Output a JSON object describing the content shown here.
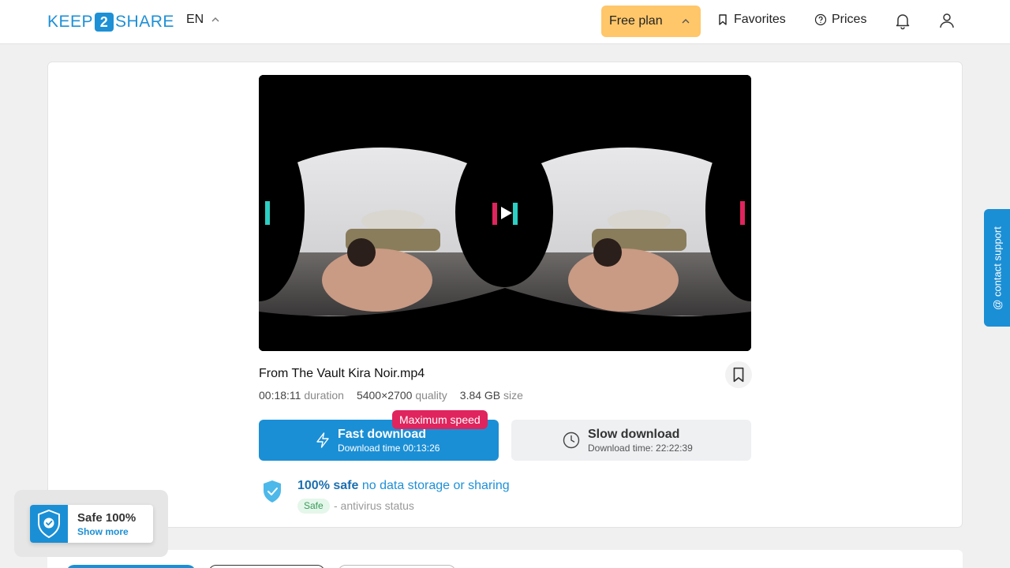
{
  "header": {
    "logo": {
      "left": "KEEP",
      "mid": "2",
      "right": "SHARE"
    },
    "lang": "EN",
    "plan": "Free plan",
    "nav": {
      "favorites": "Favorites",
      "prices": "Prices"
    }
  },
  "file": {
    "name": "From The Vault Kira Noir.mp4",
    "duration_value": "00:18:11",
    "duration_label": "duration",
    "quality_value": "5400×2700",
    "quality_label": "quality",
    "size_value": "3.84 GB",
    "size_label": "size"
  },
  "download": {
    "badge": "Maximum speed",
    "fast_title": "Fast download",
    "fast_sub": "Download time 00:13:26",
    "slow_title": "Slow download",
    "slow_sub": "Download time: 22:22:39"
  },
  "safety": {
    "strong": "100% safe",
    "rest": "no data storage or sharing",
    "pill": "Safe",
    "status": "- antivirus status"
  },
  "support": {
    "label": "@ contact support"
  },
  "popup": {
    "title": "Safe 100%",
    "link": "Show more"
  },
  "colors": {
    "accent": "#1b8fd5",
    "plan": "#ffc76a",
    "badge": "#e0245e"
  }
}
